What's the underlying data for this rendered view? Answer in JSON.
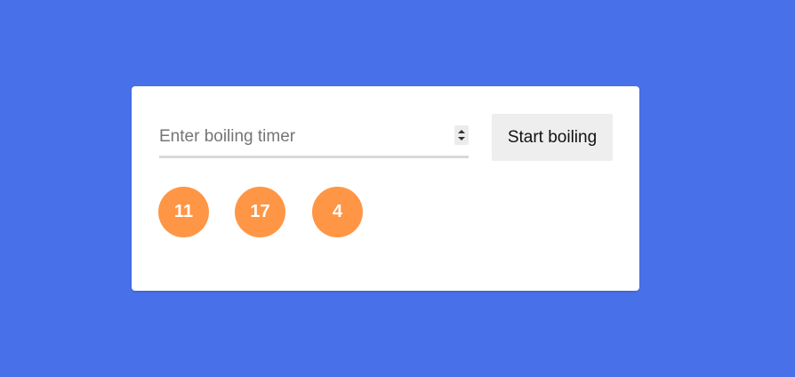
{
  "timer_form": {
    "input_value": "",
    "input_placeholder": "Enter boiling timer",
    "start_button_label": "Start boiling"
  },
  "timers": [
    {
      "value": "11"
    },
    {
      "value": "17"
    },
    {
      "value": "4"
    }
  ],
  "colors": {
    "background": "#4870e8",
    "card": "#ffffff",
    "bubble": "#ff9645",
    "button": "#eeeeee",
    "input_underline": "#d9d9d9"
  }
}
